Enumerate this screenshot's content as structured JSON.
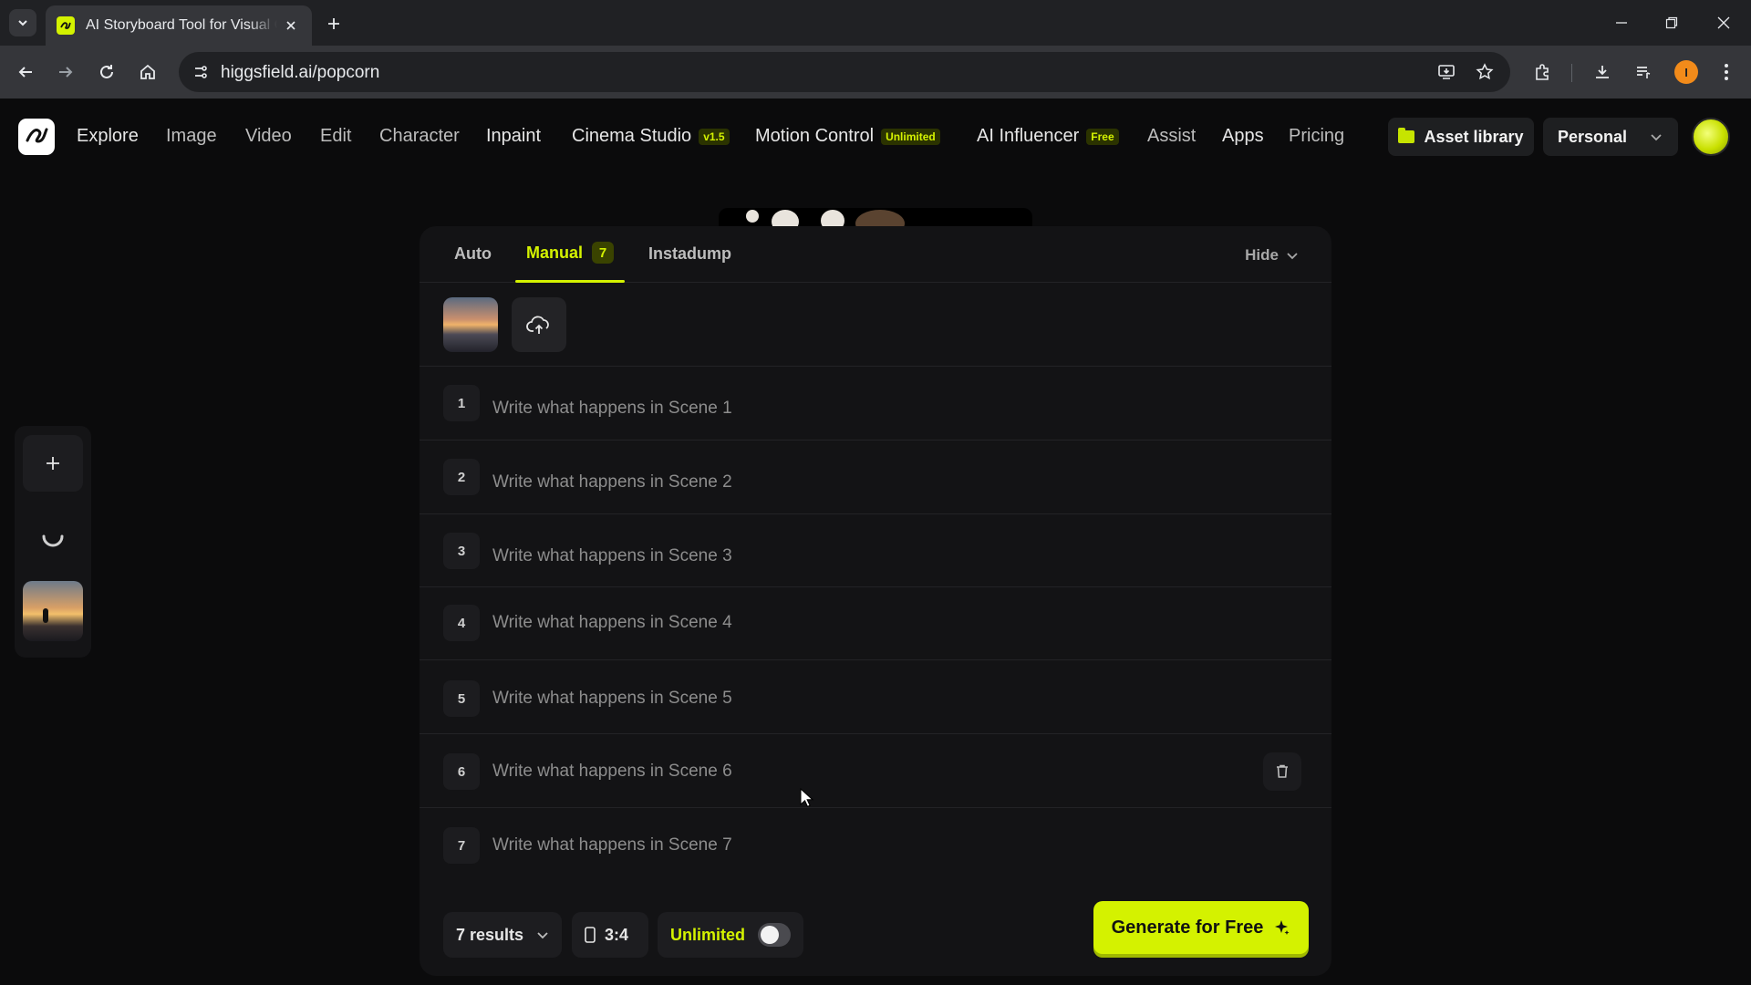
{
  "browser": {
    "tab_title": "AI Storyboard Tool for Visual Content",
    "url": "higgsfield.ai/popcorn",
    "profile_initial": "I"
  },
  "nav": {
    "items": [
      {
        "label": "Explore",
        "badge": ""
      },
      {
        "label": "Image",
        "badge": ""
      },
      {
        "label": "Video",
        "badge": ""
      },
      {
        "label": "Edit",
        "badge": ""
      },
      {
        "label": "Character",
        "badge": ""
      },
      {
        "label": "Inpaint",
        "badge": ""
      },
      {
        "label": "Cinema Studio",
        "badge": "v1.5"
      },
      {
        "label": "Motion Control",
        "badge": "Unlimited"
      },
      {
        "label": "AI Influencer",
        "badge": "Free"
      },
      {
        "label": "Assist",
        "badge": ""
      },
      {
        "label": "Apps",
        "badge": ""
      },
      {
        "label": "Pricing",
        "badge": ""
      }
    ],
    "asset_library": "Asset library",
    "workspace": "Personal"
  },
  "tabs": {
    "auto": "Auto",
    "manual": "Manual",
    "manual_count": "7",
    "instadump": "Instadump",
    "hide": "Hide"
  },
  "scenes": [
    {
      "number": "1",
      "placeholder": "Write what happens in Scene 1"
    },
    {
      "number": "2",
      "placeholder": "Write what happens in Scene 2"
    },
    {
      "number": "3",
      "placeholder": "Write what happens in Scene 3"
    },
    {
      "number": "4",
      "placeholder": "Write what happens in Scene 4"
    },
    {
      "number": "5",
      "placeholder": "Write what happens in Scene 5"
    },
    {
      "number": "6",
      "placeholder": "Write what happens in Scene 6"
    },
    {
      "number": "7",
      "placeholder": "Write what happens in Scene 7"
    }
  ],
  "bottom": {
    "results": "7 results",
    "aspect_ratio": "3:4",
    "unlimited_label": "Unlimited",
    "unlimited_on": false,
    "generate": "Generate for Free"
  },
  "colors": {
    "accent": "#d4f200",
    "background": "#0b0b0c",
    "card": "#131315"
  },
  "icons": [
    "search-icon",
    "upload-cloud-icon",
    "trash-icon",
    "sparkle-icon",
    "chevron-down-icon",
    "plus-icon",
    "folder-icon"
  ]
}
